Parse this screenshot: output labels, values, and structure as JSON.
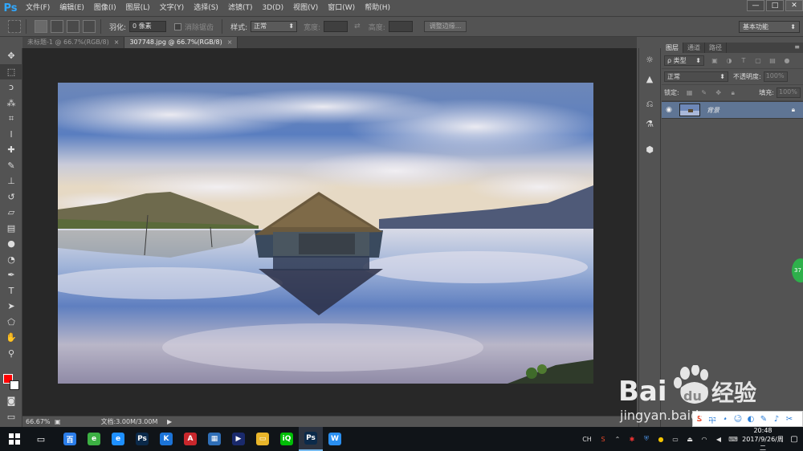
{
  "app": {
    "logo": "Ps"
  },
  "menu": [
    "文件(F)",
    "编辑(E)",
    "图像(I)",
    "图层(L)",
    "文字(Y)",
    "选择(S)",
    "滤镜(T)",
    "3D(D)",
    "视图(V)",
    "窗口(W)",
    "帮助(H)"
  ],
  "window_controls": {
    "minimize": "—",
    "maximize": "□",
    "close": "✕"
  },
  "options": {
    "feather_label": "羽化:",
    "feather_value": "0 像素",
    "antialias_label": "消除锯齿",
    "style_label": "样式:",
    "style_value": "正常",
    "width_label": "宽度:",
    "height_label": "高度:",
    "refine_edge": "调整边缘...",
    "workspace": "基本功能"
  },
  "tabs": [
    {
      "label": "未标题-1 @ 66.7%(RGB/8)",
      "active": false
    },
    {
      "label": "307748.jpg @ 66.7%(RGB/8)",
      "active": true
    }
  ],
  "tools": [
    {
      "icon": "move-tool-icon",
      "glyph": "✥"
    },
    {
      "icon": "marquee-tool-icon",
      "glyph": "⬚"
    },
    {
      "icon": "lasso-tool-icon",
      "glyph": "ↄ"
    },
    {
      "icon": "quick-select-tool-icon",
      "glyph": "⁂"
    },
    {
      "icon": "crop-tool-icon",
      "glyph": "⌗"
    },
    {
      "icon": "eyedropper-tool-icon",
      "glyph": "ⅼ"
    },
    {
      "icon": "healing-brush-tool-icon",
      "glyph": "✚"
    },
    {
      "icon": "brush-tool-icon",
      "glyph": "✎"
    },
    {
      "icon": "clone-stamp-tool-icon",
      "glyph": "⊥"
    },
    {
      "icon": "history-brush-tool-icon",
      "glyph": "↺"
    },
    {
      "icon": "eraser-tool-icon",
      "glyph": "▱"
    },
    {
      "icon": "gradient-tool-icon",
      "glyph": "▤"
    },
    {
      "icon": "blur-tool-icon",
      "glyph": "●"
    },
    {
      "icon": "dodge-tool-icon",
      "glyph": "◔"
    },
    {
      "icon": "pen-tool-icon",
      "glyph": "✒"
    },
    {
      "icon": "type-tool-icon",
      "glyph": "T"
    },
    {
      "icon": "path-select-tool-icon",
      "glyph": "➤"
    },
    {
      "icon": "shape-tool-icon",
      "glyph": "⬠"
    },
    {
      "icon": "hand-tool-icon",
      "glyph": "✋"
    },
    {
      "icon": "zoom-tool-icon",
      "glyph": "⚲"
    }
  ],
  "colors": {
    "foreground": "#ff0000",
    "background": "#ffffff"
  },
  "status": {
    "zoom": "66.67%",
    "doc": "文档:3.00M/3.00M"
  },
  "panels": {
    "tabs": [
      "图层",
      "通道",
      "路径"
    ],
    "kind_filter": "ρ 类型",
    "blend_mode": "正常",
    "opacity_label": "不透明度:",
    "opacity_value": "100%",
    "lock_label": "锁定:",
    "fill_label": "填充:",
    "fill_value": "100%",
    "layer_name": "背景"
  },
  "float_badge": "37",
  "taskbar": {
    "apps": [
      {
        "name": "baidu-app-icon",
        "color": "#2b7de9",
        "glyph": "百"
      },
      {
        "name": "360-browser-icon",
        "color": "#3cb043",
        "glyph": "e"
      },
      {
        "name": "ie-browser-icon",
        "color": "#1e90ff",
        "glyph": "e"
      },
      {
        "name": "photoshop-icon",
        "color": "#0b2a4a",
        "glyph": "Ps"
      },
      {
        "name": "kugou-icon",
        "color": "#1c74d8",
        "glyph": "K"
      },
      {
        "name": "autocad-icon",
        "color": "#c9272c",
        "glyph": "A"
      },
      {
        "name": "calculator-icon",
        "color": "#2f6fb7",
        "glyph": "▦"
      },
      {
        "name": "media-player-icon",
        "color": "#1a2a6c",
        "glyph": "▶"
      },
      {
        "name": "file-explorer-icon",
        "color": "#e8b52a",
        "glyph": "▭"
      },
      {
        "name": "iqiyi-icon",
        "color": "#00be06",
        "glyph": "iQ"
      },
      {
        "name": "photoshop-active-icon",
        "color": "#0b2a4a",
        "glyph": "Ps"
      },
      {
        "name": "wps-icon",
        "color": "#2a8ff0",
        "glyph": "W"
      }
    ],
    "tray_lang": "CH",
    "time": "20:48",
    "date": "2017/9/26/周二"
  },
  "watermark": {
    "brand": "Bai",
    "brand2": "du",
    "cn": "经验",
    "url": "jingyan.baidu.com"
  }
}
